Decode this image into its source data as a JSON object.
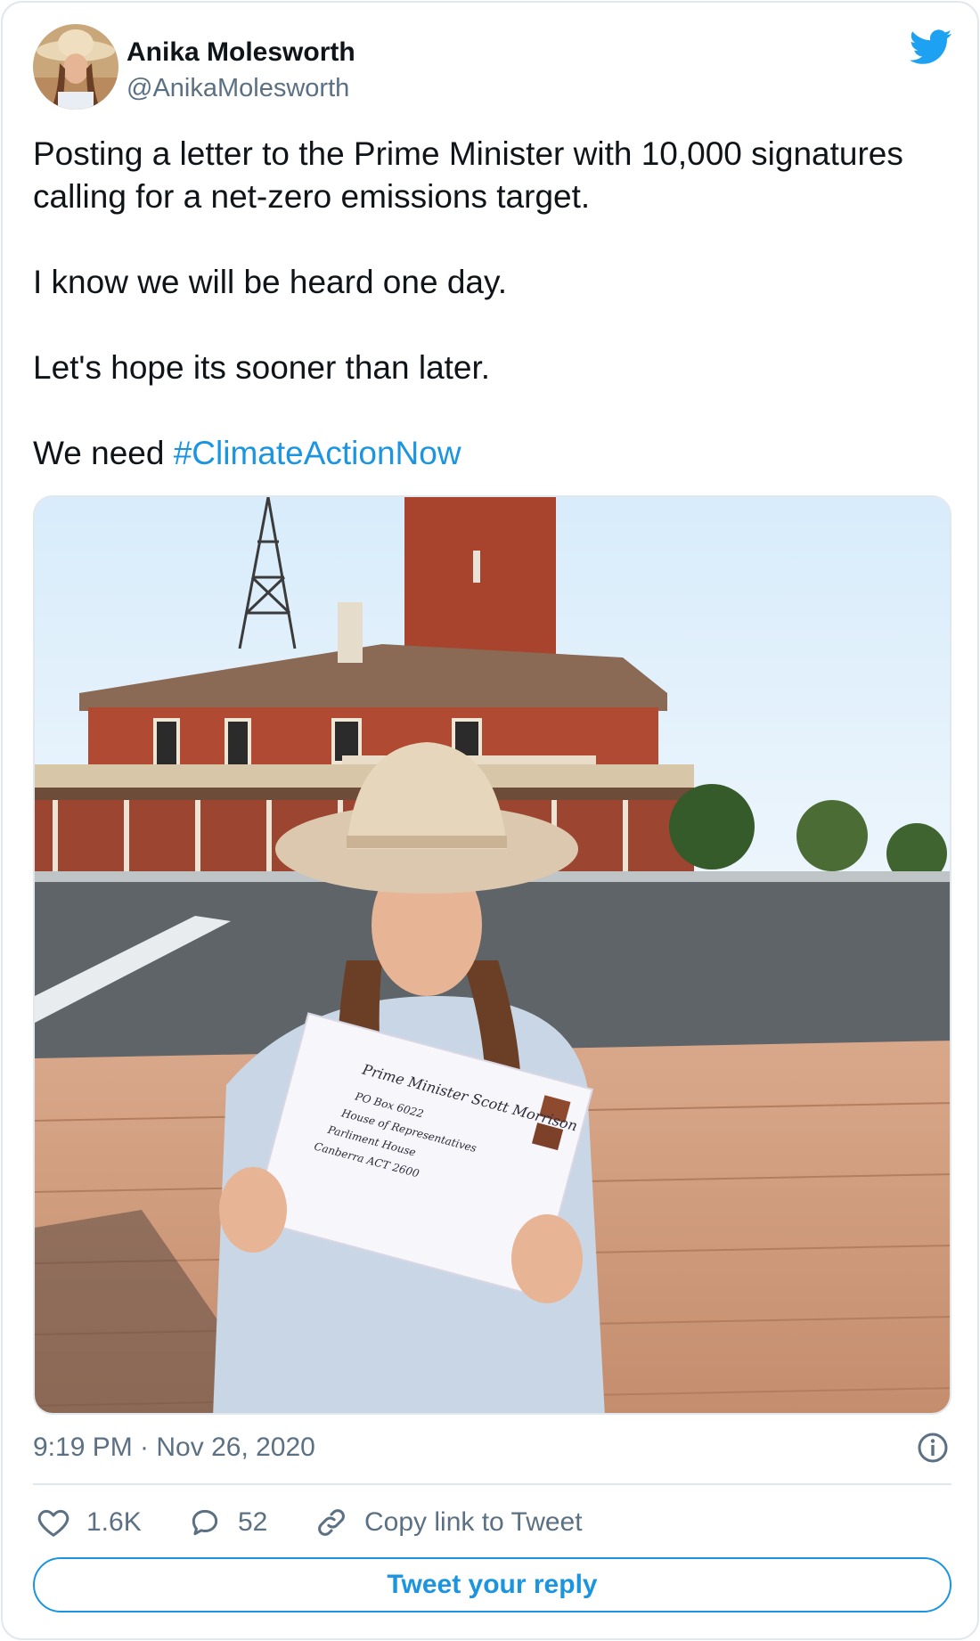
{
  "author": {
    "name": "Anika Molesworth",
    "handle": "@AnikaMolesworth"
  },
  "tweet": {
    "line1": "Posting a letter to the Prime Minister with 10,000 signatures calling for a net-zero emissions target.",
    "line2": "I know we will be heard one day.",
    "line3": "Let's hope its sooner than later.",
    "line4_prefix": "We need ",
    "hashtag": "#ClimateActionNow"
  },
  "photo": {
    "envelope": {
      "line1": "Prime Minister Scott Morrison",
      "line2": "PO Box 6022",
      "line3": "House of Representatives",
      "line4": "Parliment House",
      "line5": "Canberra ACT 2600"
    }
  },
  "meta": {
    "timestamp": "9:19 PM · Nov 26, 2020"
  },
  "actions": {
    "likes": "1.6K",
    "replies": "52",
    "copy_link": "Copy link to Tweet",
    "reply_button": "Tweet your reply"
  },
  "colors": {
    "accent": "#1b95e0",
    "secondary_text": "#5b7083",
    "border": "#e1e8ed"
  },
  "icons": [
    "twitter-bird-icon",
    "info-icon",
    "heart-icon",
    "reply-bubble-icon",
    "link-icon"
  ]
}
